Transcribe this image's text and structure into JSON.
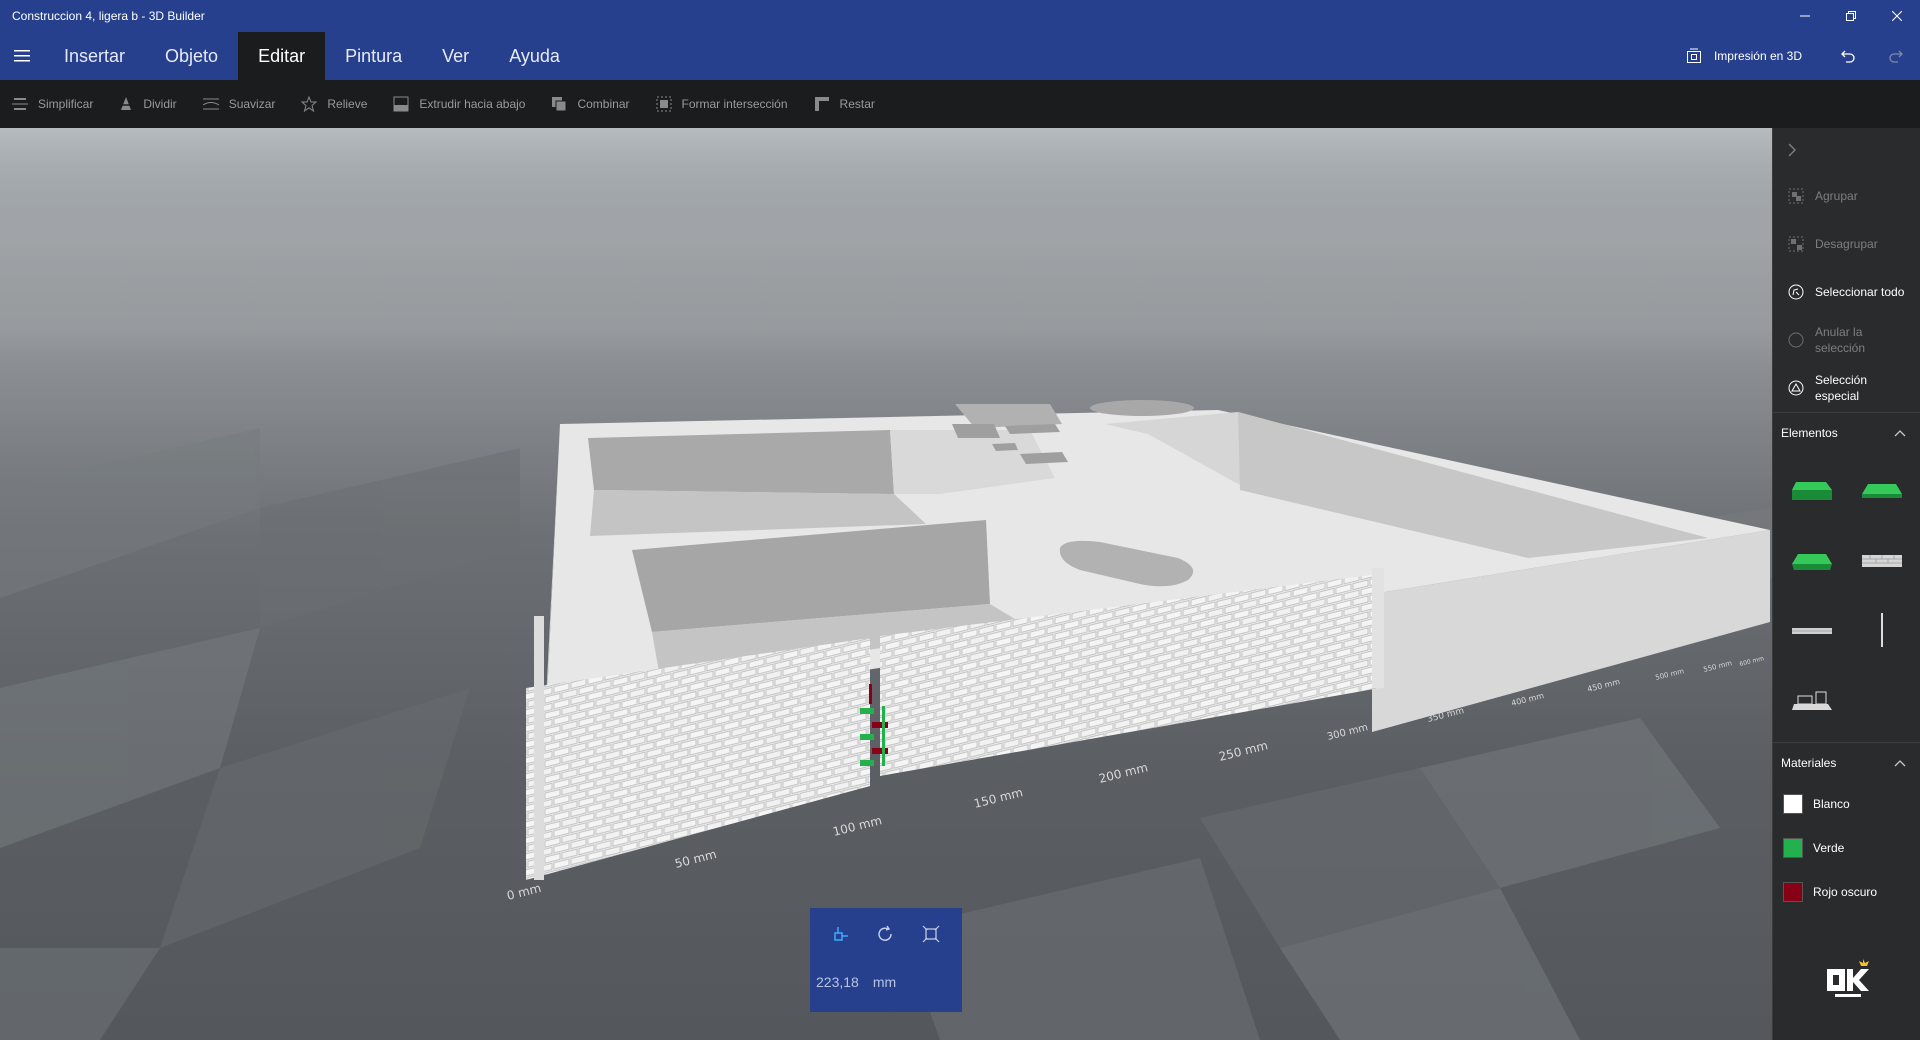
{
  "window": {
    "title": "Construccion 4, ligera b - 3D Builder",
    "controls": [
      "minimize",
      "restore",
      "close"
    ]
  },
  "menu": {
    "tabs": [
      {
        "label": "Insertar",
        "active": false
      },
      {
        "label": "Objeto",
        "active": false
      },
      {
        "label": "Editar",
        "active": true
      },
      {
        "label": "Pintura",
        "active": false
      },
      {
        "label": "Ver",
        "active": false
      },
      {
        "label": "Ayuda",
        "active": false
      }
    ],
    "print_label": "Impresión en 3D"
  },
  "toolbar": {
    "tools": [
      {
        "label": "Simplificar",
        "icon": "simplify-icon"
      },
      {
        "label": "Dividir",
        "icon": "split-icon"
      },
      {
        "label": "Suavizar",
        "icon": "smooth-icon"
      },
      {
        "label": "Relieve",
        "icon": "emboss-icon"
      },
      {
        "label": "Extrudir hacia abajo",
        "icon": "extrude-down-icon"
      },
      {
        "label": "Combinar",
        "icon": "merge-icon"
      },
      {
        "label": "Formar intersección",
        "icon": "intersect-icon"
      },
      {
        "label": "Restar",
        "icon": "subtract-icon"
      }
    ]
  },
  "panel": {
    "actions": [
      {
        "label": "Agrupar",
        "enabled": false,
        "icon": "group-icon"
      },
      {
        "label": "Desagrupar",
        "enabled": false,
        "icon": "ungroup-icon"
      },
      {
        "label": "Seleccionar todo",
        "enabled": true,
        "icon": "select-all-icon"
      },
      {
        "label": "Anular la selección",
        "enabled": false,
        "icon": "deselect-icon"
      },
      {
        "label": "Selección especial",
        "enabled": true,
        "icon": "special-selection-icon"
      }
    ],
    "elements_title": "Elementos",
    "materials_title": "Materiales",
    "materials": [
      {
        "label": "Blanco",
        "color": "#ffffff"
      },
      {
        "label": "Verde",
        "color": "#22b14c"
      },
      {
        "label": "Rojo oscuro",
        "color": "#880015"
      }
    ]
  },
  "scene": {
    "ruler_labels": [
      "0 mm",
      "50 mm",
      "100 mm",
      "150 mm",
      "200 mm",
      "250 mm",
      "300 mm",
      "350 mm",
      "400 mm",
      "450 mm",
      "500 mm",
      "550 mm",
      "600 mm"
    ]
  },
  "transform": {
    "value": "223,18",
    "unit": "mm",
    "tools": [
      "move-icon",
      "rotate-icon",
      "scale-icon"
    ]
  },
  "colors": {
    "accent": "#27408e",
    "toolbar_bg": "#1b1c1e",
    "panel_bg": "#2a2b2d",
    "selection_green": "#22b14c",
    "selection_red": "#880015"
  }
}
